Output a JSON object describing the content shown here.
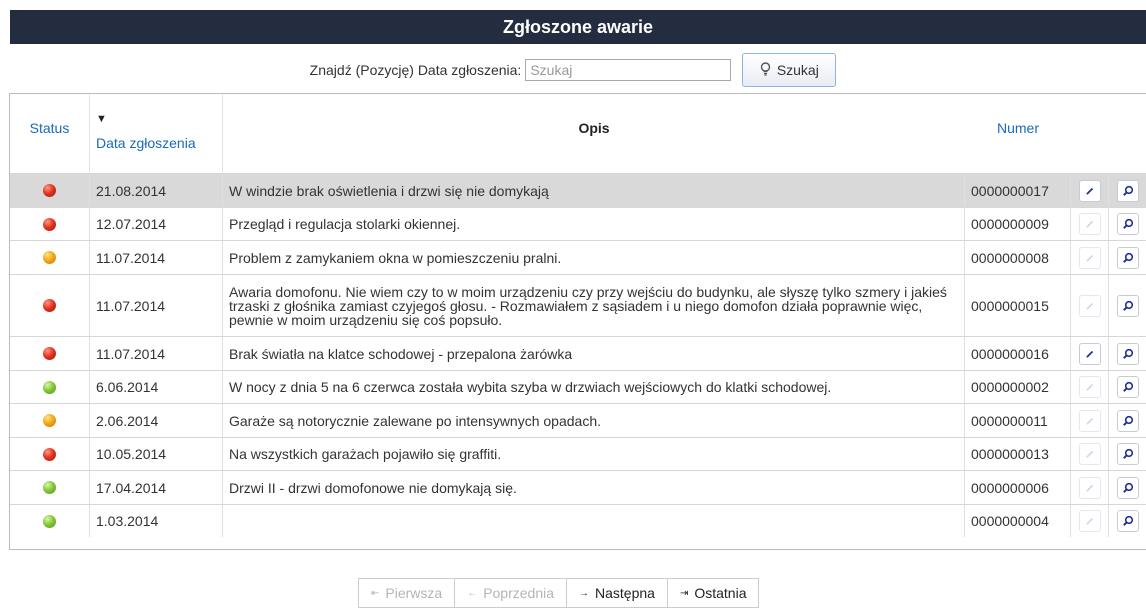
{
  "title": "Zgłoszone awarie",
  "search": {
    "label": "Znajdź (Pozycję) Data zgłoszenia:",
    "placeholder": "Szukaj",
    "value": "",
    "button_label": "Szukaj",
    "button_icon": "bulb-icon"
  },
  "grid": {
    "headers": {
      "status": "Status",
      "date": "Data zgłoszenia",
      "date_sort": "descending",
      "description": "Opis",
      "number": "Numer"
    },
    "status_colors": {
      "red": "#e2341e",
      "orange": "#f6a81a",
      "green": "#84c93a"
    },
    "rows": [
      {
        "status": "red",
        "date": "21.08.2014",
        "description": "W windzie brak oświetlenia i drzwi się nie domykają",
        "number": "0000000017",
        "edit_enabled": true,
        "selected": true
      },
      {
        "status": "red",
        "date": "12.07.2014",
        "description": "Przegląd i regulacja stolarki okiennej.",
        "number": "0000000009",
        "edit_enabled": false,
        "selected": false
      },
      {
        "status": "orange",
        "date": "11.07.2014",
        "description": "Problem z zamykaniem okna w pomieszczeniu pralni.",
        "number": "0000000008",
        "edit_enabled": false,
        "selected": false
      },
      {
        "status": "red",
        "date": "11.07.2014",
        "description": "Awaria domofonu. Nie wiem czy to w moim urządzeniu czy przy wejściu do budynku, ale słyszę tylko szmery i jakieś trzaski z głośnika zamiast czyjegoś głosu. - Rozmawiałem z sąsiadem i u niego domofon działa poprawnie więc, pewnie w moim urządzeniu się coś popsuło.",
        "number": "0000000015",
        "edit_enabled": false,
        "selected": false
      },
      {
        "status": "red",
        "date": "11.07.2014",
        "description": "Brak światła na klatce schodowej - przepalona żarówka",
        "number": "0000000016",
        "edit_enabled": true,
        "selected": false
      },
      {
        "status": "green",
        "date": "6.06.2014",
        "description": "W nocy z dnia 5 na 6 czerwca została wybita szyba w drzwiach wejściowych do klatki schodowej.",
        "number": "0000000002",
        "edit_enabled": false,
        "selected": false
      },
      {
        "status": "orange",
        "date": "2.06.2014",
        "description": "Garaże są notorycznie zalewane po intensywnych opadach.",
        "number": "0000000011",
        "edit_enabled": false,
        "selected": false
      },
      {
        "status": "red",
        "date": "10.05.2014",
        "description": "Na wszystkich garażach pojawiło się graffiti.",
        "number": "0000000013",
        "edit_enabled": false,
        "selected": false
      },
      {
        "status": "green",
        "date": "17.04.2014",
        "description": "Drzwi II - drzwi domofonowe nie domykają się.",
        "number": "0000000006",
        "edit_enabled": false,
        "selected": false
      },
      {
        "status": "green",
        "date": "1.03.2014",
        "description": "",
        "number": "0000000004",
        "edit_enabled": false,
        "selected": false
      }
    ]
  },
  "pager": {
    "first": {
      "label": "Pierwsza",
      "icon": "first-page-icon",
      "enabled": false
    },
    "prev": {
      "label": "Poprzednia",
      "icon": "previous-arrow-icon",
      "enabled": false
    },
    "next": {
      "label": "Następna",
      "icon": "next-arrow-icon",
      "enabled": true
    },
    "last": {
      "label": "Ostatnia",
      "icon": "last-page-icon",
      "enabled": true
    }
  }
}
